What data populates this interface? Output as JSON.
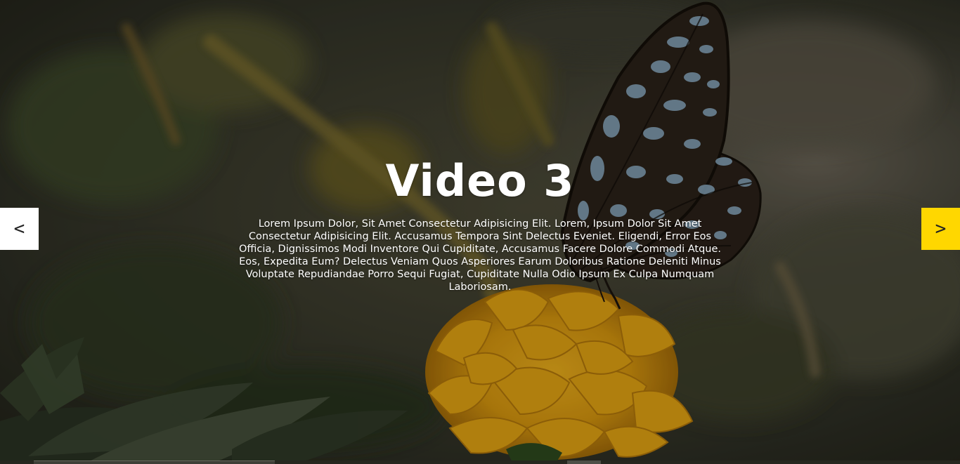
{
  "slide": {
    "title": "Video 3",
    "description": "Lorem Ipsum Dolor, Sit Amet Consectetur Adipisicing Elit. Lorem, Ipsum Dolor Sit Amet Consectetur Adipisicing Elit. Accusamus Tempora Sint Delectus Eveniet. Eligendi, Error Eos Officia, Dignissimos Modi Inventore Qui Cupiditate, Accusamus Facere Dolore Commodi Atque. Eos, Expedita Eum? Delectus Veniam Quos Asperiores Earum Doloribus Ratione Deleniti Minus Voluptate Repudiandae Porro Sequi Fugiat, Cupiditate Nulla Odio Ipsum Ex Culpa Numquam Laboriosam."
  },
  "controls": {
    "prev_label": "<",
    "next_label": ">",
    "prev_icon": "chevron-left-icon",
    "next_icon": "chevron-right-icon"
  },
  "colors": {
    "accent": "#ffd700",
    "prev_button_bg": "#ffffff",
    "text": "#ffffff"
  },
  "background": {
    "subject": "butterfly on marigold flower",
    "icon": "background-video-frame"
  }
}
